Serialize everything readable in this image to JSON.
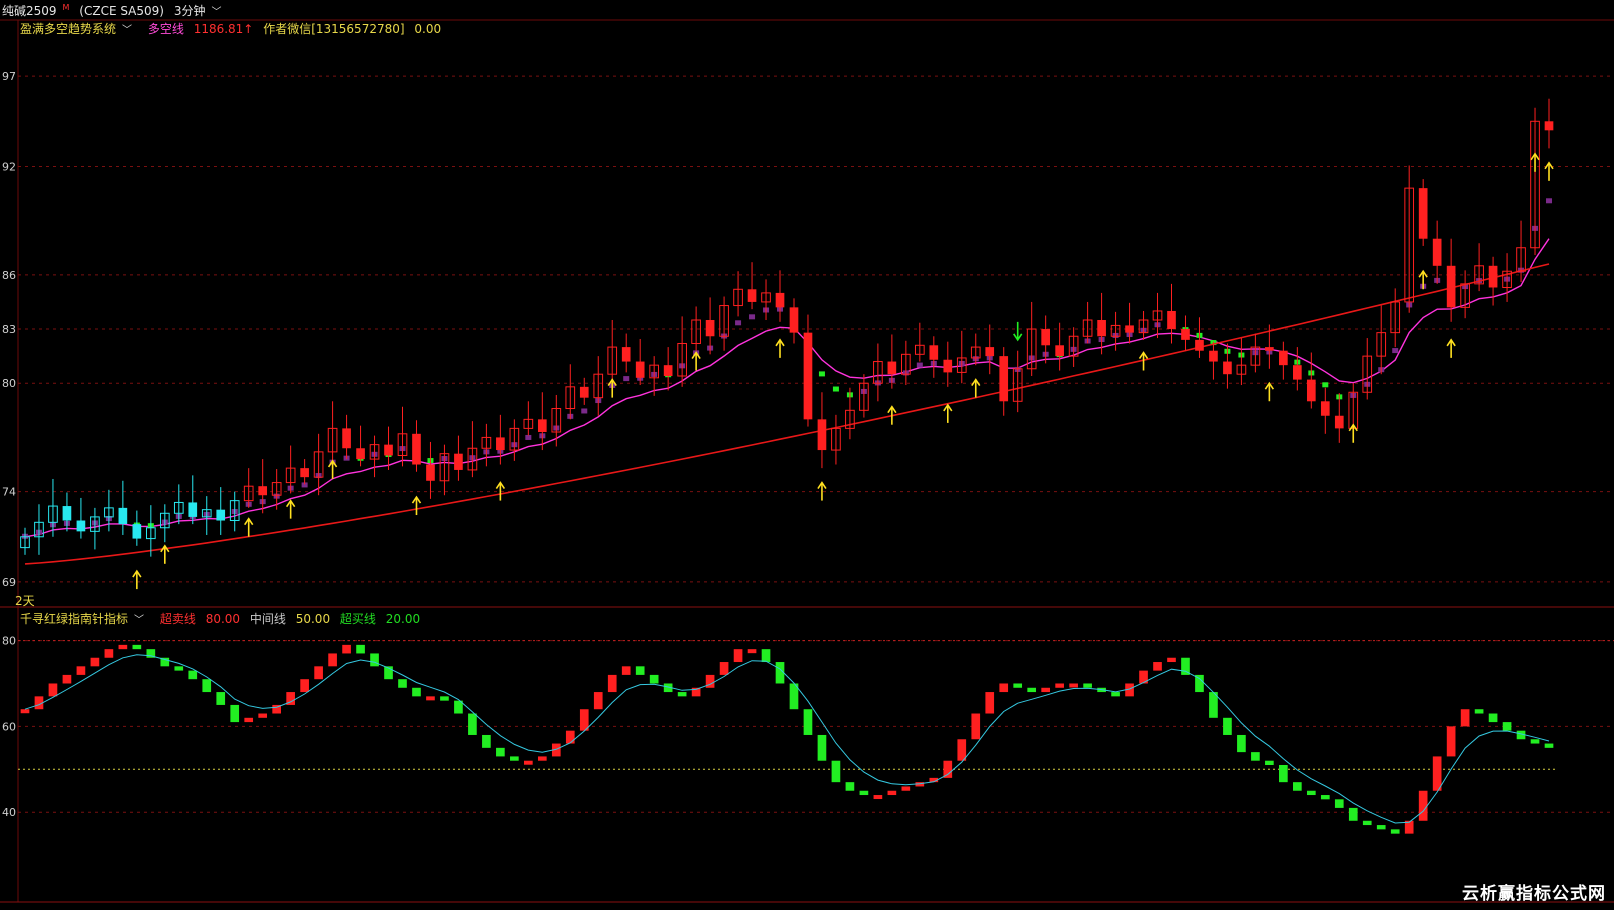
{
  "header": {
    "symbol": "纯碱2509",
    "sup": "M",
    "code": "(CZCE SA509)",
    "period": "3分钟",
    "chev": "﹀"
  },
  "indicator": {
    "name": "盈满多空趋势系统",
    "line_label": "多空线",
    "line_value": "1186.81↑",
    "author": "作者微信[13156572780]",
    "extra": "0.00"
  },
  "oscillator": {
    "name": "千寻红绿指南针指标",
    "ob_label": "超卖线",
    "ob_value": "80.00",
    "mid_label": "中间线",
    "mid_value": "50.00",
    "os_label": "超买线",
    "os_value": "20.00"
  },
  "days_label": "2天",
  "watermark": "云析赢指标公式网",
  "colors": {
    "up": "#ff2020",
    "down_candle": "#22ee22",
    "cyan": "#28e8f0",
    "magenta": "#ff33dd",
    "ma_red": "#e81818",
    "purple": "#7a2a8a",
    "arrow": "#ffe020",
    "grid": "#7a1010"
  },
  "chart_data": [
    {
      "type": "candlestick",
      "y_ticks": [
        69,
        74,
        80,
        83,
        86,
        92,
        97
      ],
      "ylim": [
        68,
        99
      ],
      "x_points": 110,
      "closes": [
        71.5,
        72.3,
        73.2,
        72.4,
        71.8,
        72.6,
        73.1,
        72.2,
        71.4,
        72.0,
        72.8,
        73.4,
        72.6,
        73.0,
        72.4,
        73.5,
        74.3,
        73.8,
        74.5,
        75.3,
        74.8,
        76.2,
        77.5,
        76.4,
        75.8,
        76.6,
        76.0,
        77.2,
        75.5,
        74.6,
        76.1,
        75.2,
        76.4,
        77.0,
        76.3,
        77.5,
        78.0,
        77.3,
        78.6,
        79.8,
        79.2,
        80.5,
        82.0,
        81.2,
        80.3,
        81.0,
        80.4,
        82.2,
        83.5,
        82.6,
        84.3,
        85.2,
        84.5,
        85.0,
        84.2,
        82.8,
        78.0,
        76.3,
        77.5,
        78.5,
        80.0,
        81.2,
        80.5,
        81.6,
        82.1,
        81.3,
        80.6,
        81.4,
        82.0,
        81.5,
        79.0,
        80.8,
        83.0,
        82.1,
        81.5,
        82.6,
        83.5,
        82.6,
        83.2,
        82.8,
        83.5,
        84.0,
        83.0,
        82.4,
        81.8,
        81.2,
        80.5,
        81.0,
        82.0,
        81.8,
        81.0,
        80.2,
        79.0,
        78.2,
        77.5,
        79.5,
        81.5,
        82.8,
        84.5,
        90.8,
        88.0,
        86.5,
        84.2,
        85.5,
        86.5,
        85.3,
        86.2,
        87.5,
        94.5,
        94.0
      ],
      "ma_red_start": 70.0,
      "ma_red_end": 86.6,
      "arrows_up_x": [
        8,
        10,
        16,
        19,
        22,
        28,
        34,
        42,
        48,
        54,
        57,
        62,
        66,
        68,
        80,
        89,
        95,
        100,
        102,
        108,
        109
      ],
      "arrows_down_x": [
        71
      ]
    },
    {
      "type": "bar-oscillator",
      "y_ticks": [
        40,
        60,
        80
      ],
      "ylim": [
        20,
        82
      ],
      "x_points": 110,
      "values": [
        64,
        67,
        70,
        72,
        74,
        76,
        78,
        79,
        78,
        76,
        74,
        73,
        71,
        68,
        65,
        61,
        62,
        63,
        65,
        68,
        71,
        74,
        77,
        79,
        77,
        74,
        71,
        69,
        67,
        67,
        66,
        63,
        58,
        55,
        53,
        52,
        52,
        53,
        56,
        59,
        64,
        68,
        72,
        74,
        72,
        70,
        68,
        67,
        69,
        72,
        75,
        78,
        78,
        75,
        70,
        64,
        58,
        52,
        47,
        45,
        44,
        44,
        45,
        46,
        47,
        48,
        52,
        57,
        63,
        68,
        70,
        69,
        68,
        69,
        70,
        70,
        69,
        68,
        67,
        70,
        73,
        75,
        76,
        72,
        68,
        62,
        58,
        54,
        52,
        51,
        47,
        45,
        44,
        43,
        41,
        38,
        37,
        36,
        35,
        38,
        45,
        53,
        60,
        64,
        63,
        61,
        59,
        57,
        56,
        55
      ]
    }
  ]
}
